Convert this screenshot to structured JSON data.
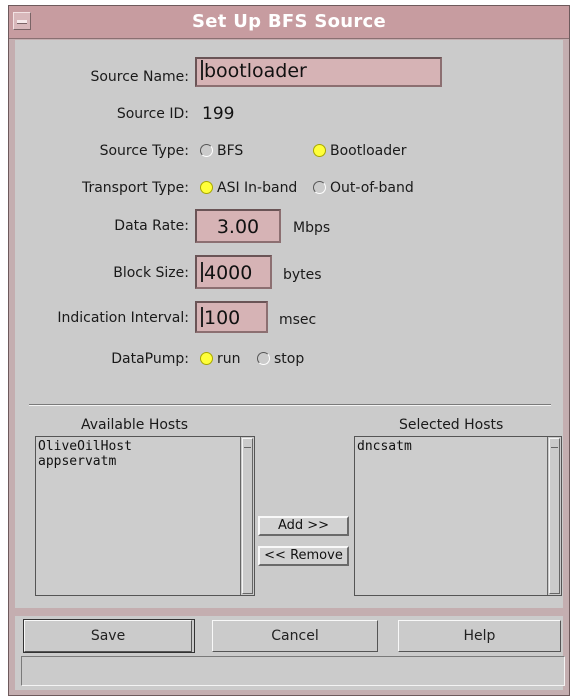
{
  "window": {
    "title": "Set Up BFS Source"
  },
  "form": {
    "source_name": {
      "label": "Source Name:",
      "value": "bootloader"
    },
    "source_id": {
      "label": "Source ID:",
      "value": "199"
    },
    "source_type": {
      "label": "Source Type:",
      "options": [
        {
          "label": "BFS",
          "selected": false
        },
        {
          "label": "Bootloader",
          "selected": true
        }
      ]
    },
    "transport_type": {
      "label": "Transport Type:",
      "options": [
        {
          "label": "ASI In-band",
          "selected": true
        },
        {
          "label": "Out-of-band",
          "selected": false
        }
      ]
    },
    "data_rate": {
      "label": "Data Rate:",
      "value": "3.00",
      "unit": "Mbps"
    },
    "block_size": {
      "label": "Block Size:",
      "value": "4000",
      "unit": "bytes"
    },
    "indication_interval": {
      "label": "Indication Interval:",
      "value": "100",
      "unit": "msec"
    },
    "datapump": {
      "label": "DataPump:",
      "options": [
        {
          "label": "run",
          "selected": true
        },
        {
          "label": "stop",
          "selected": false
        }
      ]
    }
  },
  "hosts": {
    "available_label": "Available Hosts",
    "selected_label": "Selected Hosts",
    "available": [
      "OliveOilHost",
      "appservatm"
    ],
    "selected": [
      "dncsatm"
    ],
    "add_label": "Add >>",
    "remove_label": "<< Remove"
  },
  "buttons": {
    "save": "Save",
    "cancel": "Cancel",
    "help": "Help"
  },
  "colors": {
    "titlebar": "#c79ca0",
    "field_bg": "#d6b3b5",
    "radio_on": "#ffff3a",
    "panel": "#cbcbcb"
  }
}
